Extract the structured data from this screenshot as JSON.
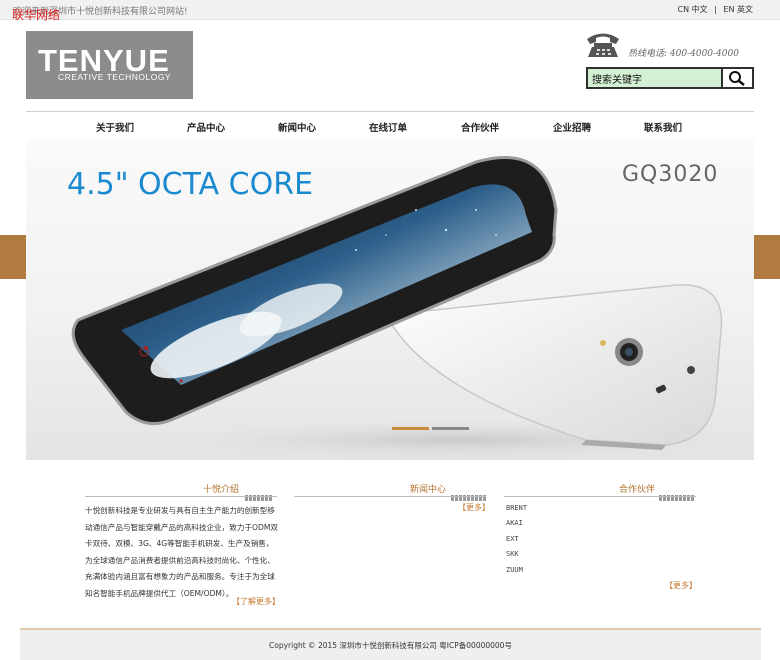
{
  "topbar": {
    "welcome": "欢迎来到深圳市十悦创新科技有限公司网站!",
    "watermark": "联华网络",
    "lang_cn": "CN 中文",
    "lang_sep": "|",
    "lang_en": "EN 英文"
  },
  "logo": {
    "name": "TENYUE",
    "tagline": "CREATIVE TECHNOLOGY"
  },
  "header": {
    "hotline": "热线电话: 400-4000-4000",
    "phone_icon": "telephone-icon"
  },
  "search": {
    "value": "搜索关键字",
    "button_icon": "magnifier-icon"
  },
  "nav": {
    "items": [
      "关于我们",
      "产品中心",
      "新闻中心",
      "在线订单",
      "合作伙伴",
      "企业招聘",
      "联系我们"
    ]
  },
  "banner": {
    "headline": "4.5\" OCTA CORE",
    "model": "GQ3020",
    "slides": 2,
    "active_slide": 1
  },
  "intro": {
    "title": "十悦介绍",
    "body": "十悦创新科技是专业研发与具有自主生产能力的创新型移动通信产品与智能穿戴产品的高科技企业，致力于ODM双卡双待、双模、3G、4G等智能手机研发、生产及销售，为全球通信产品消费者提供前沿高科技时尚化、个性化、充满体验内涵且富有想象力的产品和服务。专注于为全球知名智能手机品牌提供代工（OEM/ODM）。",
    "more": "【了解更多】"
  },
  "news": {
    "title": "新闻中心",
    "more": "【更多】"
  },
  "partners": {
    "title": "合作伙伴",
    "items": [
      "BRENT",
      "AKAI",
      "EXT",
      "SKK",
      "ZUUM"
    ],
    "more": "【更多】"
  },
  "footer": {
    "text": "Copyright © 2015 深圳市十悦创新科技有限公司 粤ICP备00000000号"
  },
  "colors": {
    "accent": "#b17a3f",
    "headline_blue": "#1a8ad0",
    "search_bg": "#d4f0d4"
  }
}
